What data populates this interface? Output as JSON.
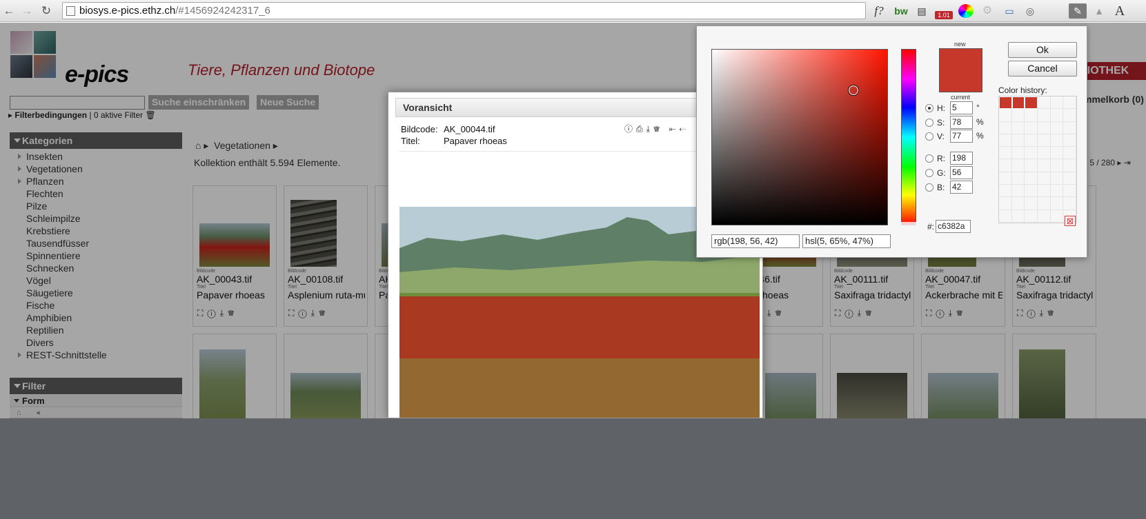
{
  "browser": {
    "url_host": "biosys.e-pics.ethz.ch",
    "url_path": "/#1456924242317_6",
    "extensions": [
      "f?",
      "bw",
      "1.01"
    ]
  },
  "site": {
    "logo_text": "e-pics",
    "subtitle": "Tiere, Pflanzen und Biotope",
    "library_banner": "LIOTHEK",
    "search_refine_button": "Suche einschränken",
    "new_search_button": "Neue Suche",
    "filter_conditions": "Filterbedingungen",
    "active_filters": "| 0 aktive Filter",
    "basket": "mmelkorb (0)",
    "pager": "5 / 280"
  },
  "sidebar": {
    "categories_title": "Kategorien",
    "categories": [
      {
        "label": "Insekten",
        "expandable": true
      },
      {
        "label": "Vegetationen",
        "expandable": true
      },
      {
        "label": "Pflanzen",
        "expandable": true
      },
      {
        "label": "Flechten",
        "expandable": false
      },
      {
        "label": "Pilze",
        "expandable": false
      },
      {
        "label": "Schleimpilze",
        "expandable": false
      },
      {
        "label": "Krebstiere",
        "expandable": false
      },
      {
        "label": "Tausendfüsser",
        "expandable": false
      },
      {
        "label": "Spinnentiere",
        "expandable": false
      },
      {
        "label": "Schnecken",
        "expandable": false
      },
      {
        "label": "Vögel",
        "expandable": false
      },
      {
        "label": "Säugetiere",
        "expandable": false
      },
      {
        "label": "Fische",
        "expandable": false
      },
      {
        "label": "Amphibien",
        "expandable": false
      },
      {
        "label": "Reptilien",
        "expandable": false
      },
      {
        "label": "Divers",
        "expandable": false
      },
      {
        "label": "REST-Schnittstelle",
        "expandable": true
      }
    ],
    "filter_title": "Filter",
    "form_label": "Form"
  },
  "main": {
    "breadcrumb": "Vegetationen",
    "collection_count": "Kollektion enthält 5.594 Elemente.",
    "tiles": [
      {
        "label_code": "Bildcode",
        "code": "AK_00043.tif",
        "label_title": "Titel",
        "title": "Papaver rhoeas"
      },
      {
        "label_code": "Bildcode",
        "code": "AK_00108.tif",
        "label_title": "Titel",
        "title": "Asplenium ruta-mu"
      },
      {
        "label_code": "Bildcode",
        "code": "AK",
        "label_title": "Titel",
        "title": "Pa"
      },
      {
        "label_code": "Bildcode",
        "code": "00046.tif",
        "label_title": "Titel",
        "title": "ver rhoeas"
      },
      {
        "label_code": "Bildcode",
        "code": "AK_00111.tif",
        "label_title": "Titel",
        "title": "Saxifraga tridactylit"
      },
      {
        "label_code": "Bildcode",
        "code": "AK_00047.tif",
        "label_title": "Titel",
        "title": "Ackerbrache mit Ec"
      },
      {
        "label_code": "Bildcode",
        "code": "AK_00112.tif",
        "label_title": "Titel",
        "title": "Saxifraga tridactylit"
      }
    ]
  },
  "preview": {
    "title": "Voransicht",
    "code_label": "Bildcode:",
    "code": "AK_00044.tif",
    "title_label": "Titel:",
    "image_title": "Papaver rhoeas"
  },
  "colorpicker": {
    "new_label": "new",
    "current_label": "current",
    "ok": "Ok",
    "cancel": "Cancel",
    "h": "5",
    "s": "78",
    "v": "77",
    "r": "198",
    "g": "56",
    "b": "42",
    "hex_label": "#:",
    "hex": "c6382a",
    "rgb_text": "rgb(198, 56, 42)",
    "hsl_text": "hsl(5, 65%, 47%)",
    "history_label": "Color history:",
    "current_color": "#c6382a",
    "history_colors": [
      "#c6382a",
      "#c6382a",
      "#c6382a"
    ]
  }
}
